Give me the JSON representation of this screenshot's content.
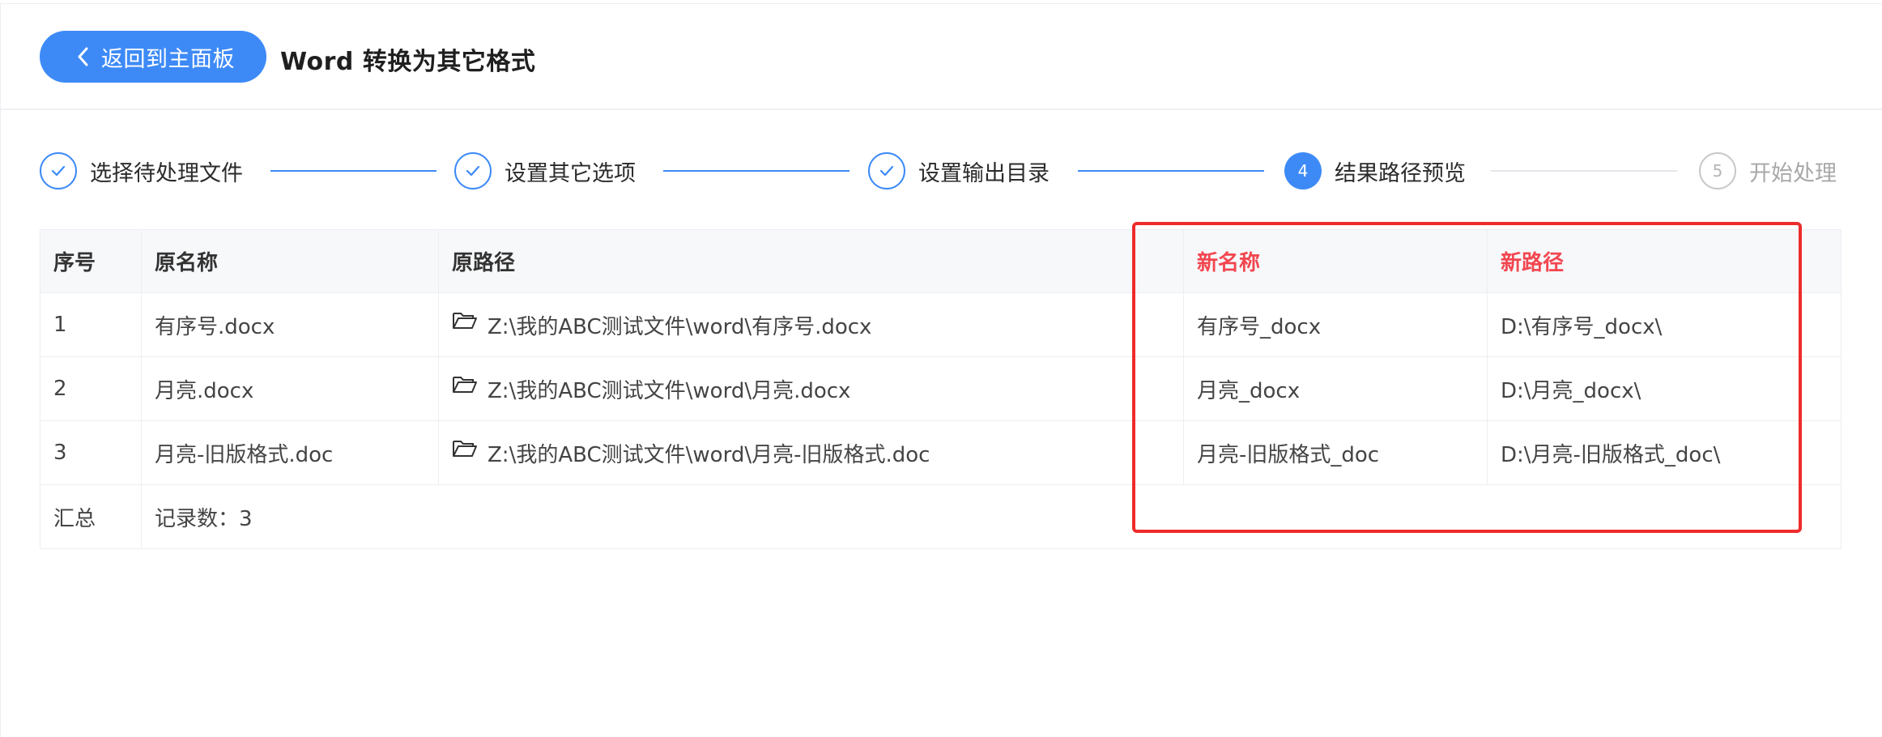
{
  "header": {
    "back_label": "返回到主面板",
    "title": "Word 转换为其它格式"
  },
  "steps": [
    {
      "number": "1",
      "label": "选择待处理文件",
      "state": "done"
    },
    {
      "number": "2",
      "label": "设置其它选项",
      "state": "done"
    },
    {
      "number": "3",
      "label": "设置输出目录",
      "state": "done"
    },
    {
      "number": "4",
      "label": "结果路径预览",
      "state": "active"
    },
    {
      "number": "5",
      "label": "开始处理",
      "state": "todo"
    }
  ],
  "table": {
    "columns": [
      "序号",
      "原名称",
      "原路径",
      "新名称",
      "新路径"
    ],
    "rows": [
      {
        "index": "1",
        "name": "有序号.docx",
        "path": "Z:\\我的ABC测试文件\\word\\有序号.docx",
        "new_name": "有序号_docx",
        "new_path": "D:\\有序号_docx\\"
      },
      {
        "index": "2",
        "name": "月亮.docx",
        "path": "Z:\\我的ABC测试文件\\word\\月亮.docx",
        "new_name": "月亮_docx",
        "new_path": "D:\\月亮_docx\\"
      },
      {
        "index": "3",
        "name": "月亮-旧版格式.doc",
        "path": "Z:\\我的ABC测试文件\\word\\月亮-旧版格式.doc",
        "new_name": "月亮-旧版格式_doc",
        "new_path": "D:\\月亮-旧版格式_doc\\"
      }
    ],
    "summary": {
      "label": "汇总",
      "value": "记录数：3"
    }
  },
  "colors": {
    "accent": "#3d8af7",
    "highlight": "#ee2b2b",
    "red_header": "#f2464f"
  }
}
